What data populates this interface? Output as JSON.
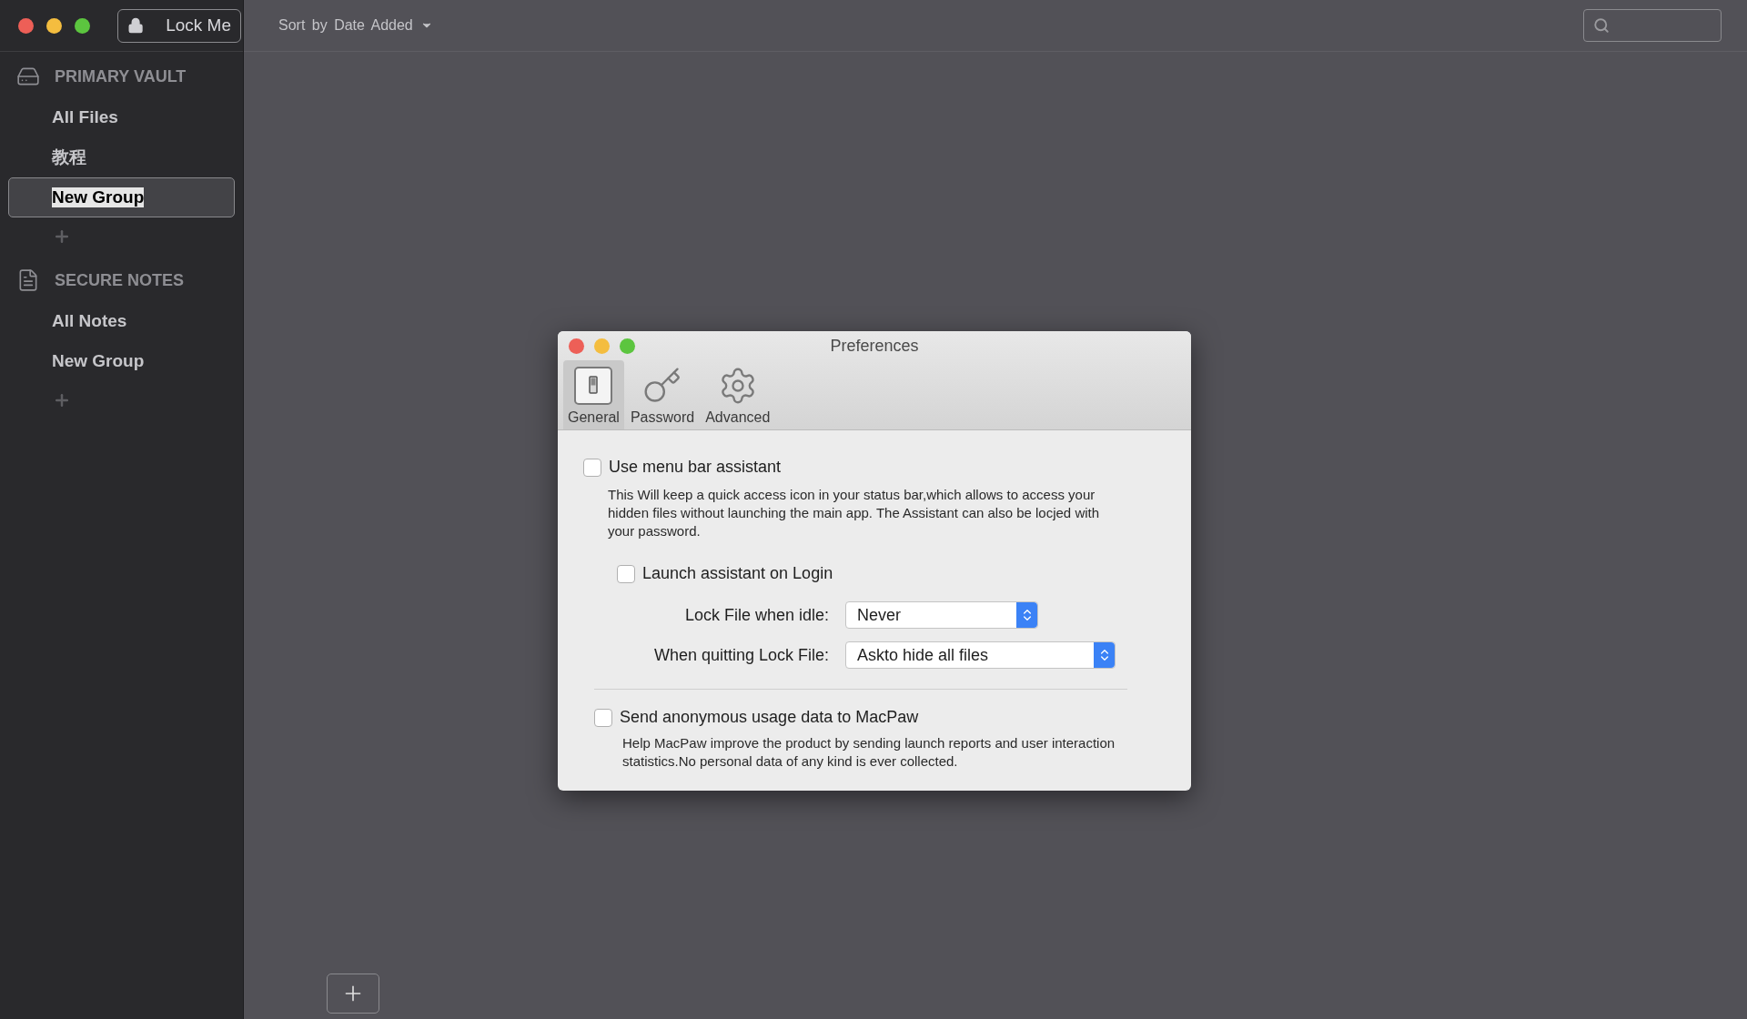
{
  "toolbar": {
    "lock_button": "Lock Me",
    "sort_menu": "Sort by Date Added"
  },
  "sidebar": {
    "sections": [
      {
        "title": "PRIMARY VAULT",
        "kind": "vault",
        "items": [
          {
            "label": "All Files",
            "selected": false
          },
          {
            "label": "教程",
            "selected": false
          },
          {
            "label": "New Group",
            "selected": true
          }
        ]
      },
      {
        "title": "SECURE NOTES",
        "kind": "notes",
        "items": [
          {
            "label": "All Notes",
            "selected": false
          },
          {
            "label": "New Group",
            "selected": false
          }
        ]
      }
    ]
  },
  "preferences": {
    "title": "Preferences",
    "tabs": [
      {
        "label": "General",
        "kind": "general",
        "selected": true
      },
      {
        "label": "Password",
        "kind": "password",
        "selected": false
      },
      {
        "label": "Advanced",
        "kind": "advanced",
        "selected": false
      }
    ],
    "menu_bar_assistant": {
      "label": "Use menu bar assistant",
      "checked": false,
      "description": "This Will keep a quick access icon in your status bar,which allows to access your hidden files without launching the main app. The Assistant can also be locjed with your password."
    },
    "launch_on_login": {
      "label": "Launch assistant on Login",
      "checked": false
    },
    "selects": [
      {
        "label": "Lock File when idle:",
        "value": "Never",
        "kind": "short"
      },
      {
        "label": "When quitting Lock File:",
        "value": "Askto hide all files",
        "kind": "long"
      }
    ],
    "usage_data": {
      "label": "Send anonymous usage data to MacPaw",
      "checked": false,
      "description": "Help MacPaw improve the product by sending launch reports and user interaction statistics.No personal data of any kind is ever collected."
    }
  }
}
